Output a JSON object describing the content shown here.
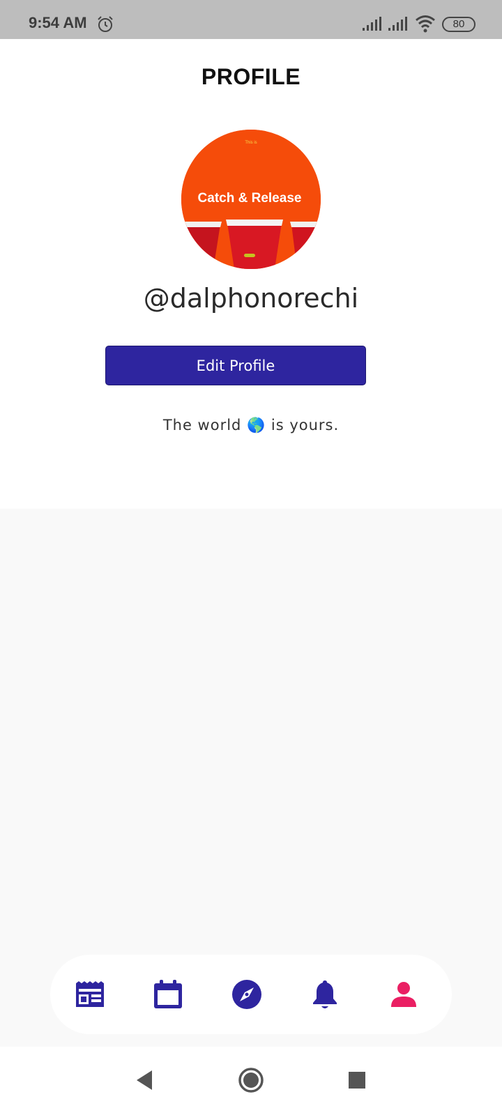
{
  "status_bar": {
    "time": "9:54 AM",
    "battery": "80",
    "icons": [
      "alarm-icon",
      "signal-icon",
      "signal-icon",
      "wifi-icon",
      "battery-icon"
    ]
  },
  "header": {
    "title": "PROFILE"
  },
  "profile": {
    "avatar": {
      "small_text": "This is",
      "title": "Catch & Release"
    },
    "username": "@dalphonorechi",
    "edit_button_label": "Edit Profile",
    "bio": "The world 🌎 is yours."
  },
  "bottom_nav": {
    "items": [
      {
        "icon": "news-icon",
        "active": false
      },
      {
        "icon": "calendar-icon",
        "active": false
      },
      {
        "icon": "compass-icon",
        "active": false
      },
      {
        "icon": "bell-icon",
        "active": false
      },
      {
        "icon": "person-icon",
        "active": true
      }
    ]
  },
  "system_nav": {
    "icons": [
      "back-icon",
      "home-icon",
      "recents-icon"
    ]
  },
  "colors": {
    "primary": "#2e259f",
    "active": "#ea1f63",
    "avatar_bg": "#f54c0a",
    "status_bar": "#bdbdbd"
  }
}
